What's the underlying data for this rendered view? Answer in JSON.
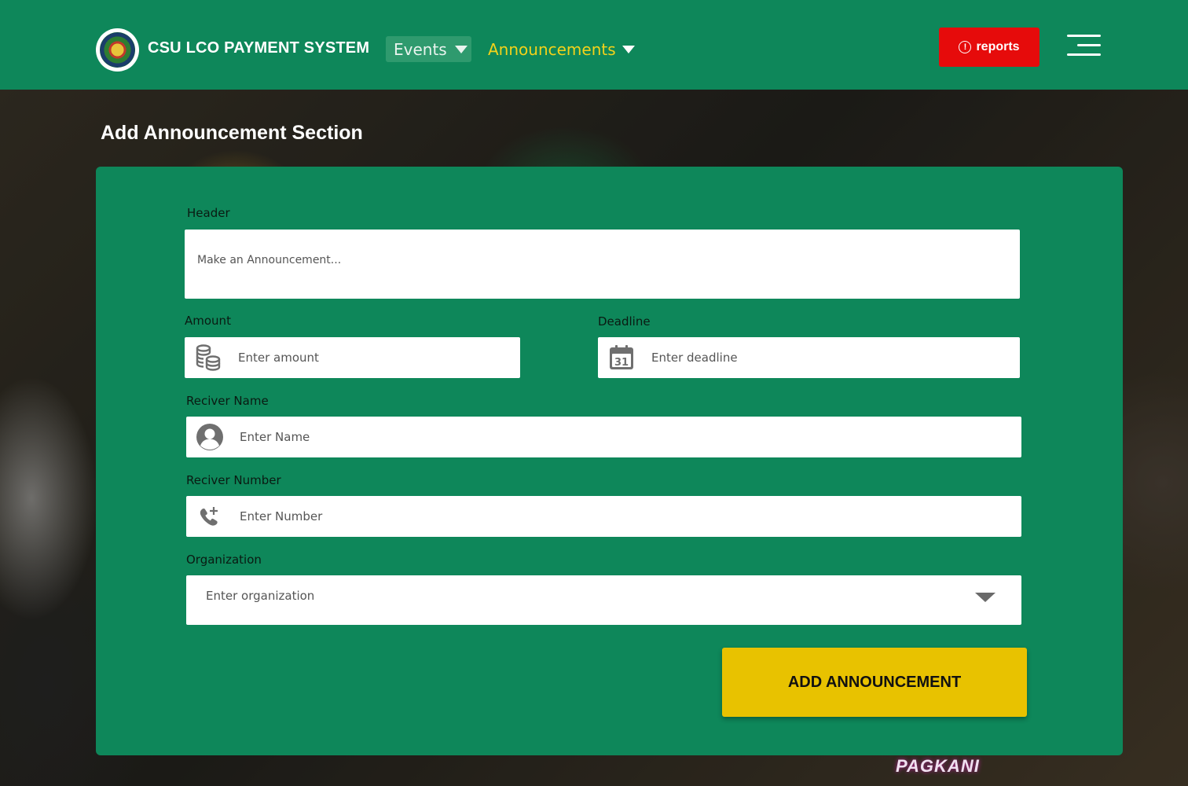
{
  "nav": {
    "brand": "CSU LCO PAYMENT SYSTEM",
    "events_label": "Events",
    "announcements_label": "Announcements",
    "reports_label": "reports",
    "colors": {
      "nav_bg": "#0e875a",
      "active": "#f3d21a",
      "reports_bg": "#e60b0b"
    }
  },
  "page": {
    "title": "Add Announcement Section"
  },
  "form": {
    "header": {
      "label": "Header",
      "placeholder": "Make an Announcement..."
    },
    "amount": {
      "label": "Amount",
      "placeholder": "Enter amount",
      "icon": "coins-icon"
    },
    "deadline": {
      "label": "Deadline",
      "placeholder": "Enter deadline",
      "icon": "calendar-icon",
      "calendar_day": "31"
    },
    "receiver_name": {
      "label": "Reciver Name",
      "placeholder": "Enter Name",
      "icon": "user-icon"
    },
    "receiver_number": {
      "label": "Reciver Number",
      "placeholder": "Enter Number",
      "icon": "phone-add-icon"
    },
    "organization": {
      "label": "Organization",
      "placeholder": "Enter organization"
    },
    "submit_label": "ADD ANNOUNCEMENT",
    "colors": {
      "card_bg": "#0e875a",
      "submit_bg": "#e8c200"
    }
  },
  "background": {
    "badge_text": "PAGKANI"
  }
}
